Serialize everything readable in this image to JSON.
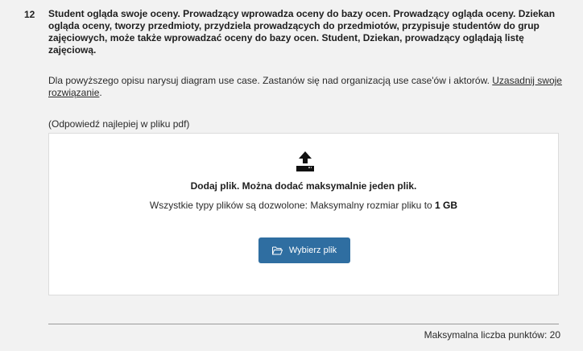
{
  "question": {
    "number": "12",
    "text": "Student ogląda swoje oceny. Prowadzący wprowadza oceny do bazy ocen. Prowadzący ogląda oceny. Dziekan ogląda oceny, tworzy przedmioty, przydziela prowadzących do przedmiotów, przypisuje studentów do grup zajęciowych, może także wprowadzać oceny do bazy ocen.  Student, Dziekan, prowadzący oglądają listę zajęciową.",
    "instruction": "Dla powyższego opisu narysuj diagram use case. Zastanów się nad organizacją use case'ów i aktorów. ",
    "instruction_link": "Uzasadnij swoje rozwiązanie",
    "instruction_end": ".",
    "hint": "(Odpowiedź najlepiej w pliku pdf)"
  },
  "upload": {
    "icon": "upload-icon",
    "title": "Dodaj plik. Można dodać maksymalnie jeden plik.",
    "info_prefix": "Wszystkie typy plików są dozwolone: Maksymalny rozmiar pliku to ",
    "info_size": "1 GB",
    "button_label": "Wybierz plik",
    "button_icon": "folder-open-icon",
    "button_color": "#2f6ea1"
  },
  "footer": {
    "max_points": "Maksymalna liczba punktów: 20"
  }
}
